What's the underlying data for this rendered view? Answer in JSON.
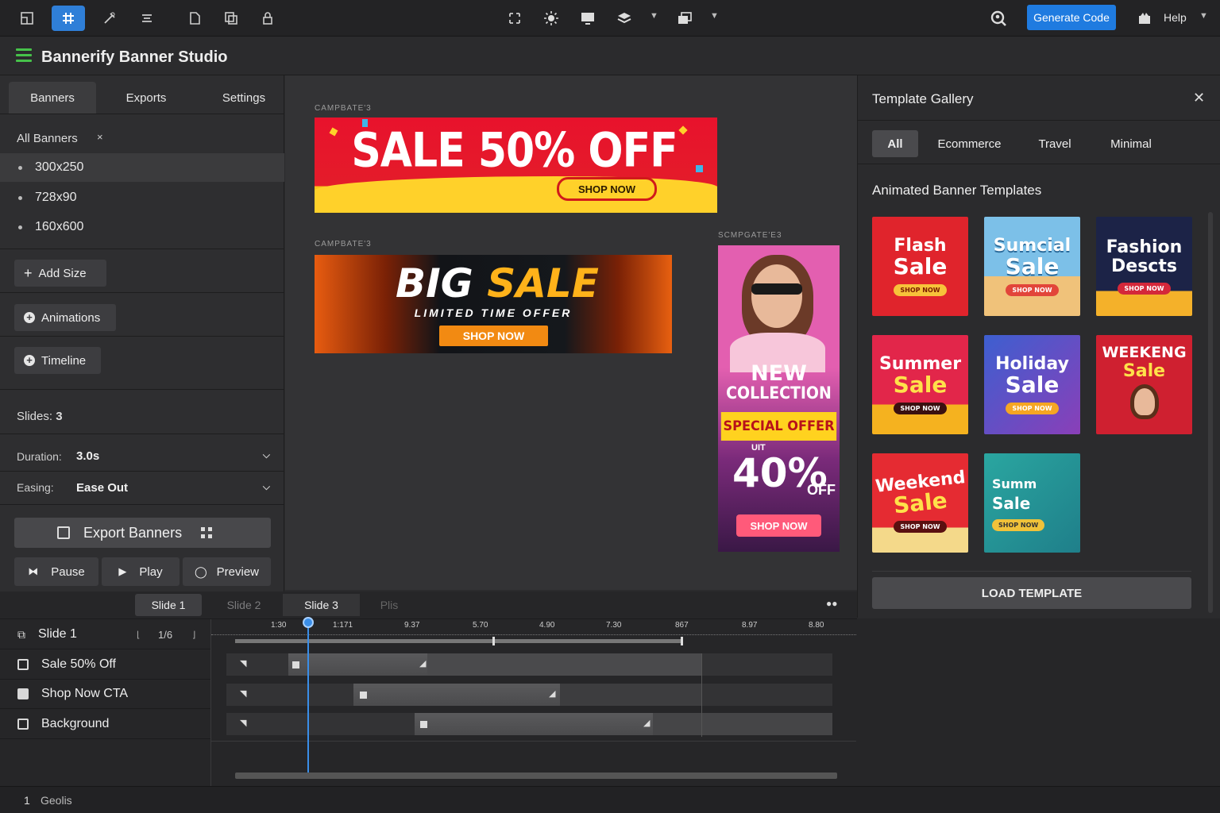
{
  "toolbar": {
    "generate_label": "Generate Code",
    "help_label": "Help",
    "accent": "#1f7be0"
  },
  "app": {
    "title": "Bannerify Banner Studio"
  },
  "left": {
    "tabs": [
      "Banners",
      "Exports",
      "Settings"
    ],
    "all_banners": "All Banners",
    "all_banners_x": "×",
    "sizes": [
      "300x250",
      "728x90",
      "160x600"
    ],
    "add_size": "Add Size",
    "animations": "Animations",
    "timeline": "Timeline",
    "slides_label": "Slides:",
    "slides_value": "3",
    "duration_label": "Duration:",
    "duration_value": "3.0s",
    "easing_label": "Easing:",
    "easing_value": "Ease Out",
    "export_label": "Export Banners",
    "pause": "Pause",
    "play": "Play",
    "preview": "Preview"
  },
  "canvas": {
    "banner1": {
      "caption": "CAMPBATE'3",
      "headline": "SALE 50% OFF",
      "cta": "SHOP NOW"
    },
    "banner2": {
      "caption": "CAMPBATE'3",
      "headline_a": "BIG",
      "headline_b": "SALE",
      "sub": "LIMITED TIME OFFER",
      "cta": "SHOP NOW"
    },
    "banner3": {
      "caption": "SCMPGATE'E3",
      "line1": "NEW",
      "line2": "COLLECTION",
      "offer": "SPECIAL OFFER",
      "upto": "UIT",
      "pct": "40%",
      "off": "OFF",
      "cta": "SHOP NOW"
    }
  },
  "gallery": {
    "title": "Template Gallery",
    "close": "✕",
    "tabs": [
      "All",
      "Ecommerce",
      "Travel",
      "Minimal"
    ],
    "section": "Animated Banner Templates",
    "cards": [
      {
        "l1": "Flash",
        "l2": "Sale",
        "btn": "SHOP NOW",
        "bg": "#e0242c",
        "fg": "#ffffff"
      },
      {
        "l1": "Sumcial",
        "l2": "Sale",
        "btn": "SHOP NOW",
        "bg": "#5aa7d8",
        "fg": "#ffffff"
      },
      {
        "l1": "Fashion",
        "l2": "Descts",
        "btn": "SHOP NOW",
        "bg": "#1c2347",
        "fg": "#ffffff"
      },
      {
        "l1": "Summer",
        "l2": "Sale",
        "btn": "SHOP NOW",
        "bg": "#e2264a",
        "fg": "#ffe14a"
      },
      {
        "l1": "Holiday",
        "l2": "Sale",
        "btn": "SHOP NOW",
        "bg": "#6a3fa8",
        "fg": "#ffffff"
      },
      {
        "l1": "WEEKENG",
        "l2": "Sale",
        "btn": "",
        "bg": "#cf2030",
        "fg": "#ffe14a"
      },
      {
        "l1": "Weekend",
        "l2": "Sale",
        "btn": "SHOP NOW",
        "bg": "#e52b32",
        "fg": "#ffffff"
      },
      {
        "l1": "Summ",
        "l2": "Sale",
        "btn": "SHOP NOW",
        "bg": "#2aa6a0",
        "fg": "#ffffff"
      }
    ],
    "load": "LOAD TEMPLATE"
  },
  "timeline": {
    "tabs": [
      "Slide 1",
      "Slide 2",
      "Slide 3",
      "Plis"
    ],
    "ticks": [
      "1:30",
      "1:171",
      "9.37",
      "5.70",
      "4.90",
      "7.30",
      "867",
      "8.97",
      "8.80"
    ],
    "header_label": "Slide 1",
    "header_count": "1/6",
    "layers": [
      "Sale 50% Off",
      "Shop Now CTA",
      "Background"
    ]
  },
  "status": {
    "num": "1",
    "label": "Geolis"
  }
}
